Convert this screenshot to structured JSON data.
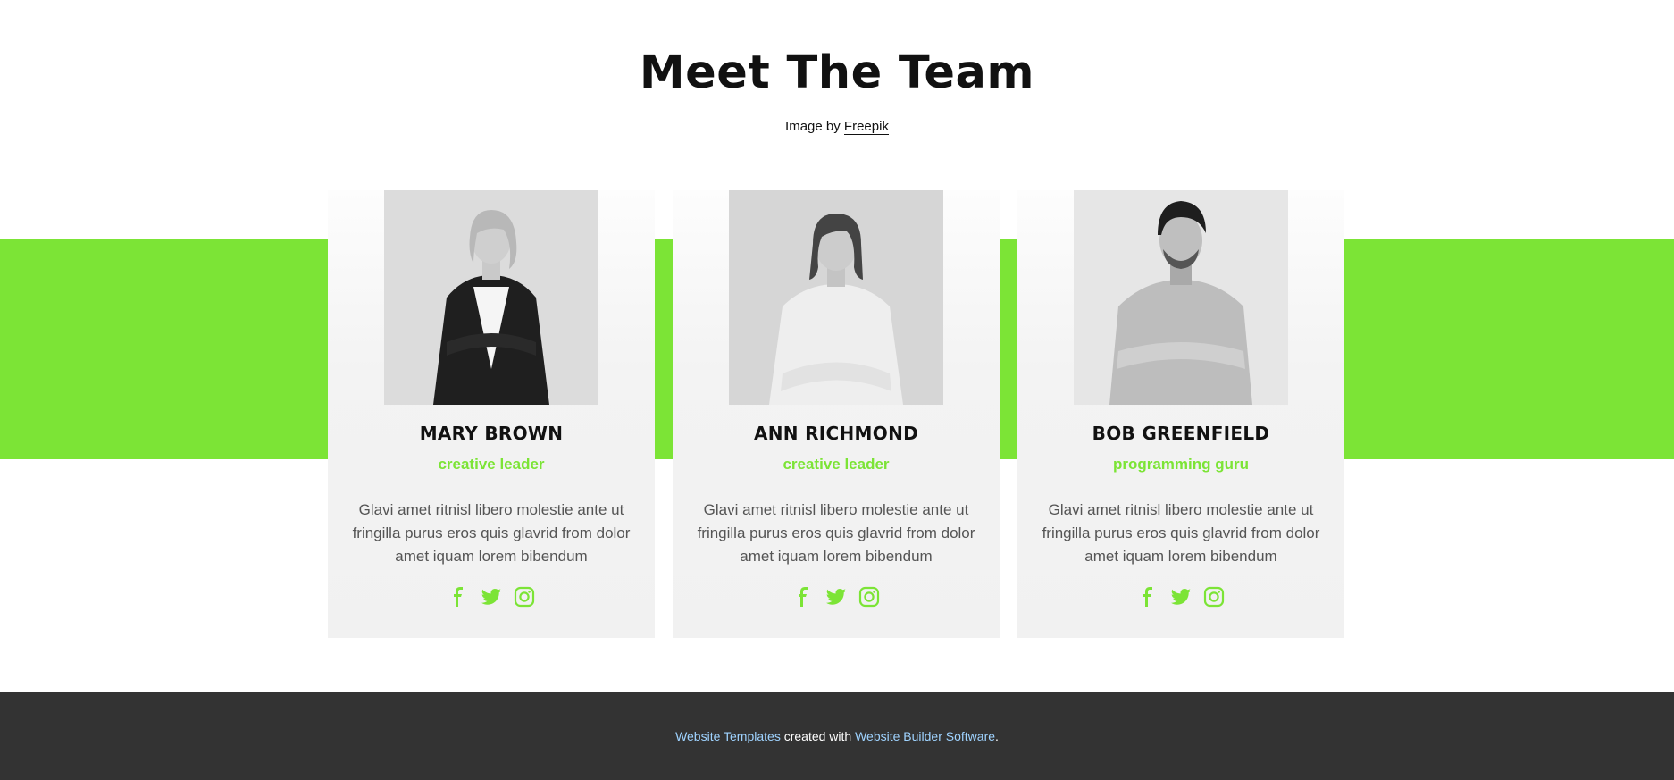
{
  "section": {
    "title": "Meet The Team",
    "credit_prefix": "Image by",
    "credit_link": "Freepik"
  },
  "colors": {
    "accent": "#7ce436",
    "footer_bg": "#333333",
    "card_bg": "#f2f2f2"
  },
  "team": [
    {
      "name": "MARY BROWN",
      "role": "creative leader",
      "bio": "Glavi amet ritnisl libero molestie ante ut fringilla purus eros quis glavrid from dolor amet iquam lorem bibendum",
      "social": [
        "facebook-icon",
        "twitter-icon",
        "instagram-icon"
      ]
    },
    {
      "name": "ANN RICHMOND",
      "role": "creative leader",
      "bio": "Glavi amet ritnisl libero molestie ante ut fringilla purus eros quis glavrid from dolor amet iquam lorem bibendum",
      "social": [
        "facebook-icon",
        "twitter-icon",
        "instagram-icon"
      ]
    },
    {
      "name": "BOB GREENFIELD",
      "role": "programming guru",
      "bio": "Glavi amet ritnisl libero molestie ante ut fringilla purus eros quis glavrid from dolor amet iquam lorem bibendum",
      "social": [
        "facebook-icon",
        "twitter-icon",
        "instagram-icon"
      ]
    }
  ],
  "footer": {
    "link1": "Website Templates",
    "middle": " created with ",
    "link2": "Website Builder Software",
    "end": "."
  }
}
